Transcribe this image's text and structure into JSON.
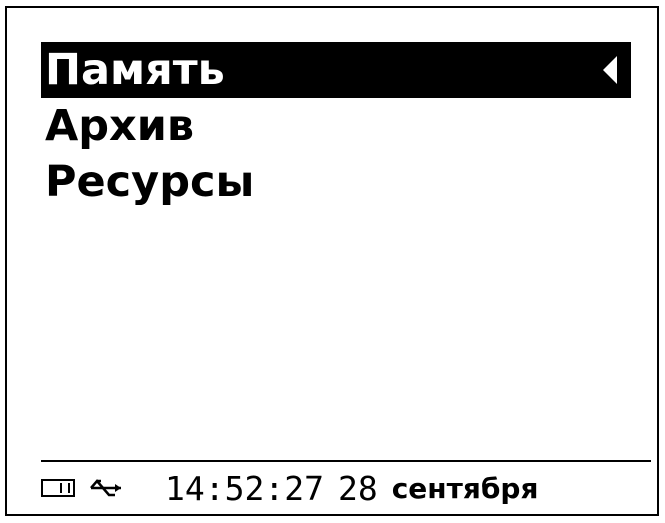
{
  "menu": {
    "items": [
      {
        "label": "Память",
        "selected": true
      },
      {
        "label": "Архив",
        "selected": false
      },
      {
        "label": "Ресурсы",
        "selected": false
      }
    ]
  },
  "status": {
    "storage_icon": "sd-card-icon",
    "connection_icon": "usb-icon",
    "time": "14:52:27",
    "day": "28",
    "month": "сентября"
  },
  "colors": {
    "background": "#ffffff",
    "foreground": "#000000",
    "selection_bg": "#000000",
    "selection_fg": "#ffffff"
  }
}
